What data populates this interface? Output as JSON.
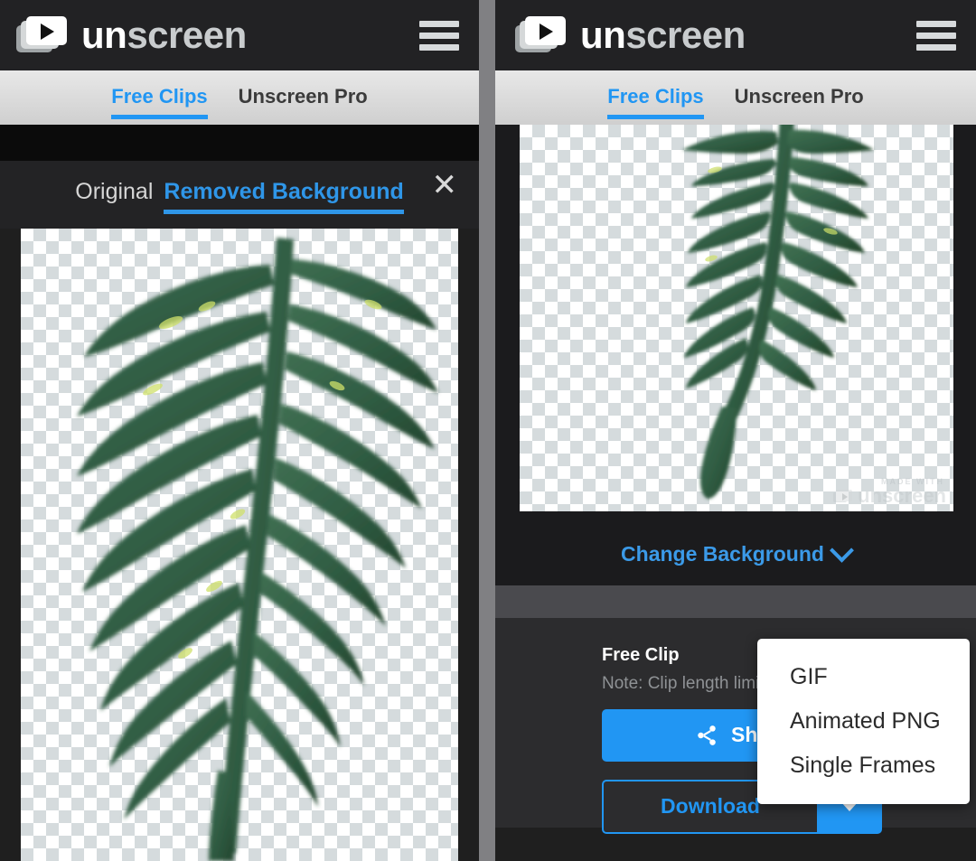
{
  "brand": {
    "name": "unscreen",
    "logo_icon": "video-stack-play-icon",
    "menu_icon": "hamburger-menu-icon"
  },
  "subnav": {
    "tabs": [
      {
        "label": "Free Clips",
        "active": true
      },
      {
        "label": "Unscreen Pro",
        "active": false
      }
    ]
  },
  "left_panel": {
    "modal": {
      "close_icon": "close-icon",
      "tabs": [
        {
          "label": "Original",
          "active": false
        },
        {
          "label": "Removed Background",
          "active": true
        }
      ]
    },
    "preview": {
      "subject": "fern-frond",
      "background": "transparent-checkerboard"
    }
  },
  "right_panel": {
    "preview": {
      "subject": "fern-frond",
      "background": "transparent-checkerboard",
      "watermark_top": "MADE WITH",
      "watermark_name": "unscreen"
    },
    "change_background": {
      "label": "Change Background",
      "chevron_icon": "chevron-down-icon"
    },
    "download": {
      "title": "Free Clip",
      "note": "Note: Clip length limited to 5 seconds.",
      "share_label": "Share",
      "share_icon": "share-nodes-icon",
      "download_label": "Download",
      "caret_icon": "caret-down-icon"
    },
    "format_menu": {
      "items": [
        "GIF",
        "Animated PNG",
        "Single Frames"
      ]
    }
  },
  "colors": {
    "accent": "#2196f3",
    "link": "#3b9ae8",
    "topbar_bg": "#222224",
    "panel_bg": "#1f1f1f",
    "subnav_bg": "#d8d8d8",
    "divider": "#808083",
    "checker_light": "#ffffff",
    "checker_dark": "#d5dbdd"
  }
}
